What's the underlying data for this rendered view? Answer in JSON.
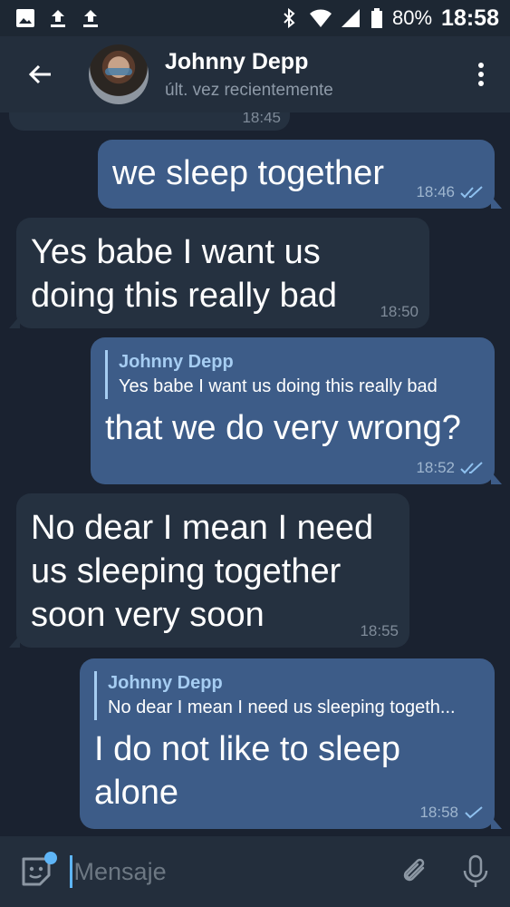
{
  "status_bar": {
    "battery": "80%",
    "time": "18:58",
    "icons": [
      "image-icon",
      "upload-icon",
      "upload-icon",
      "bluetooth-icon",
      "wifi-icon",
      "signal-icon",
      "battery-icon"
    ]
  },
  "header": {
    "name": "Johnny Depp",
    "status": "últ. vez recientemente"
  },
  "messages": [
    {
      "direction": "in",
      "text": "",
      "time": "18:45"
    },
    {
      "direction": "out",
      "text": "we sleep together",
      "time": "18:46",
      "ticks": "double"
    },
    {
      "direction": "in",
      "text": "Yes babe I want us doing this really  bad",
      "time": "18:50"
    },
    {
      "direction": "out",
      "reply_name": "Johnny Depp",
      "reply_text": "Yes babe I want us doing this really  bad",
      "text": "that we do very wrong?",
      "time": "18:52",
      "ticks": "double"
    },
    {
      "direction": "in",
      "text": "No dear I mean I need us sleeping together soon very soon",
      "time": "18:55"
    },
    {
      "direction": "out",
      "reply_name": "Johnny Depp",
      "reply_text": "No dear I mean I need us sleeping togeth...",
      "text": "I do not like to sleep alone",
      "time": "18:58",
      "ticks": "single"
    }
  ],
  "input": {
    "placeholder": "Mensaje"
  },
  "colors": {
    "background": "#1a2230",
    "header": "#232e3c",
    "incoming": "#253140",
    "outgoing": "#3d5c88",
    "accent": "#5eb5f7"
  }
}
